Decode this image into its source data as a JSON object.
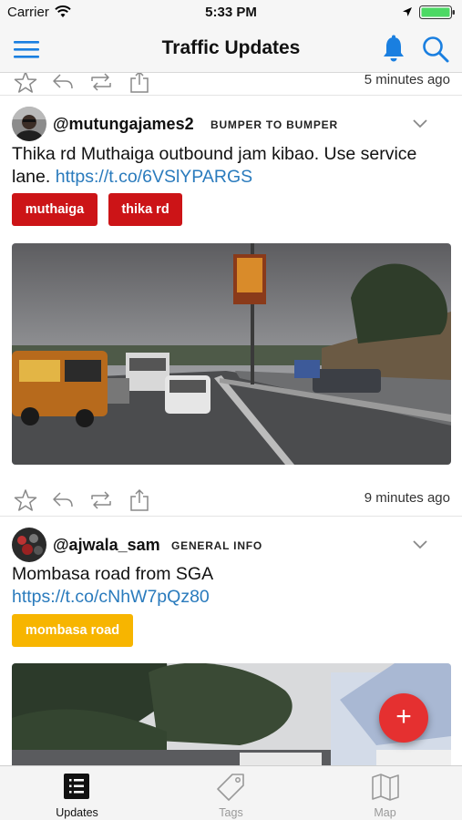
{
  "status_bar": {
    "carrier": "Carrier",
    "time": "5:33 PM",
    "icons": [
      "wifi-icon",
      "location-arrow-icon",
      "battery-icon"
    ]
  },
  "nav": {
    "title": "Traffic Updates",
    "icons": [
      "menu-icon",
      "bell-icon",
      "search-icon"
    ],
    "accent_color": "#1a7fe0"
  },
  "feed": {
    "top_actions": {
      "time": "5 minutes ago"
    },
    "posts": [
      {
        "handle": "@mutungajames2",
        "category": "BUMPER TO BUMPER",
        "text": "Thika rd Muthaiga outbound jam kibao. Use service lane.",
        "link": "https://t.co/6VSlYPARGS",
        "tags": [
          "muthaiga",
          "thika rd"
        ],
        "tag_color": "#cc1417",
        "time": "9 minutes ago"
      },
      {
        "handle": "@ajwala_sam",
        "category": "GENERAL INFO",
        "text": "Mombasa road from SGA",
        "link": "https://t.co/cNhW7pQz80",
        "tags": [
          "mombasa road"
        ],
        "tag_color": "#f7b500"
      }
    ]
  },
  "fab": {
    "label": "+",
    "color": "#e53030"
  },
  "tab_bar": {
    "tabs": [
      {
        "label": "Updates",
        "icon": "list-icon",
        "active": true
      },
      {
        "label": "Tags",
        "icon": "tag-icon",
        "active": false
      },
      {
        "label": "Map",
        "icon": "map-icon",
        "active": false
      }
    ]
  }
}
